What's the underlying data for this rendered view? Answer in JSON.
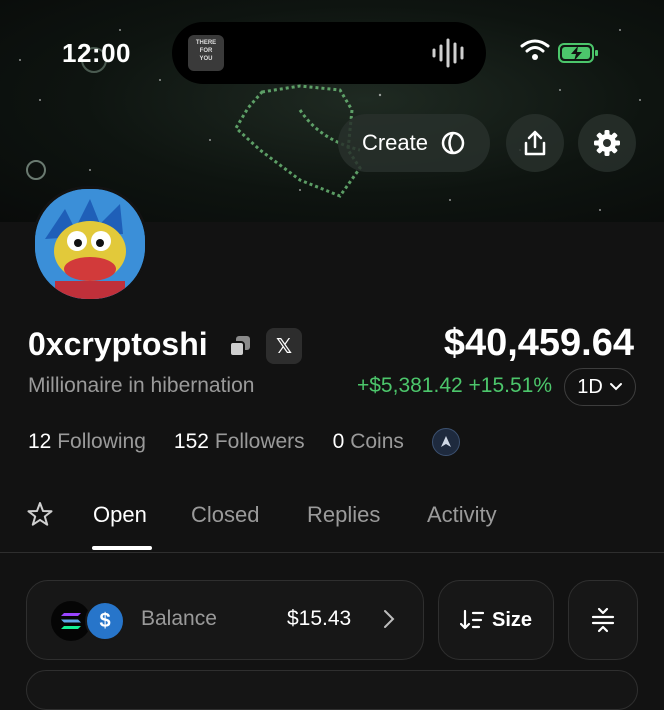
{
  "status_bar": {
    "time": "12:00",
    "now_playing": "THERE\nFOR\nYOU"
  },
  "header": {
    "create_label": "Create"
  },
  "profile": {
    "username": "0xcryptoshi",
    "x_badge": "𝕏",
    "bio": "Millionaire in hibernation",
    "following_count": "12",
    "following_label": "Following",
    "followers_count": "152",
    "followers_label": "Followers",
    "coins_count": "0",
    "coins_label": "Coins"
  },
  "portfolio": {
    "total": "$40,459.64",
    "change": "+$5,381.42 +15.51%",
    "period": "1D"
  },
  "tabs": [
    {
      "label": "Open",
      "active": true
    },
    {
      "label": "Closed",
      "active": false
    },
    {
      "label": "Replies",
      "active": false
    },
    {
      "label": "Activity",
      "active": false
    }
  ],
  "balance": {
    "label": "Balance",
    "value": "$15.43",
    "coin_b_symbol": "$"
  },
  "sort": {
    "label": "Size"
  },
  "colors": {
    "positive": "#4cc66b",
    "background": "#121212",
    "muted": "#9a9a9a"
  },
  "icons": [
    "wifi-icon",
    "battery-charging-icon",
    "create-swirl-icon",
    "share-icon",
    "gear-icon",
    "copy-icon",
    "x-logo-icon",
    "chevron-down-icon",
    "coin-badge-icon",
    "star-icon",
    "solana-icon",
    "usdc-icon",
    "chevron-right-icon",
    "sort-icon",
    "collapse-icon"
  ]
}
